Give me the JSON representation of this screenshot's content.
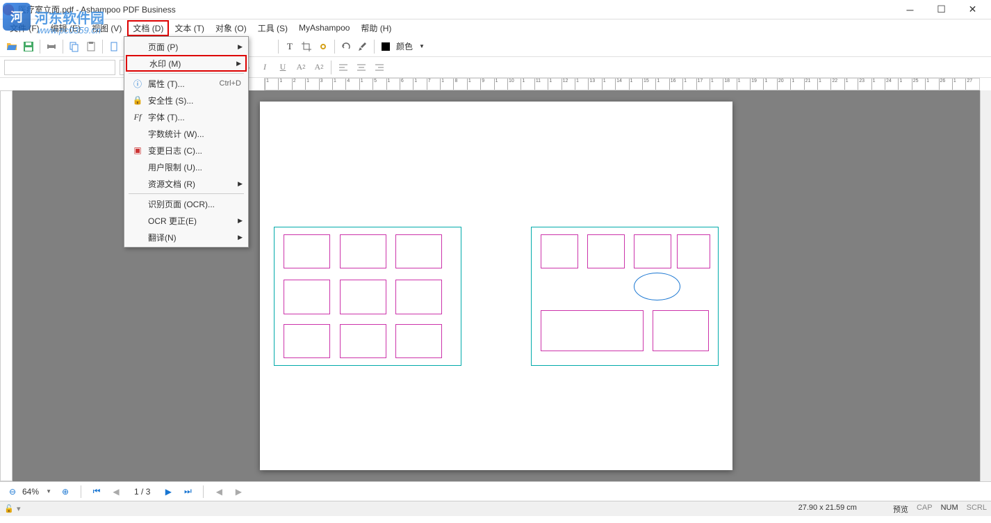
{
  "title": "医疗室立面.pdf - Ashampoo PDF Business",
  "watermark": {
    "brand": "河东软件园",
    "url": "www.pc0359.cn"
  },
  "menubar": {
    "file": "文件 (F)",
    "edit": "编辑 (E)",
    "view": "视图 (V)",
    "document": "文档 (D)",
    "text": "文本 (T)",
    "object": "对象 (O)",
    "tools": "工具 (S)",
    "myashampoo": "MyAshampoo",
    "help": "帮助 (H)"
  },
  "dropdown": {
    "page": "页面 (P)",
    "watermark": "水印 (M)",
    "properties": "属性 (T)...",
    "properties_shortcut": "Ctrl+D",
    "security": "安全性 (S)...",
    "font": "字体 (T)...",
    "wordcount": "字数统计 (W)...",
    "changelog": "变更日志 (C)...",
    "userlimit": "用户限制 (U)...",
    "resource": "资源文档 (R)",
    "ocr_page": "识别页面 (OCR)...",
    "ocr_fix": "OCR 更正(E)",
    "translate": "翻译(N)"
  },
  "toolbar": {
    "color_label": "颜色"
  },
  "ruler": [
    "1",
    "1",
    "2",
    "1",
    "3",
    "1",
    "4",
    "1",
    "5",
    "1",
    "6",
    "1",
    "7",
    "1",
    "8",
    "1",
    "9",
    "1",
    "10",
    "1",
    "11",
    "1",
    "12",
    "1",
    "13",
    "1",
    "14",
    "1",
    "15",
    "1",
    "16",
    "1",
    "17",
    "1",
    "18",
    "1",
    "19",
    "1",
    "20",
    "1",
    "21",
    "1",
    "22",
    "1",
    "23",
    "1",
    "24",
    "1",
    "25",
    "1",
    "26",
    "1",
    "27"
  ],
  "nav": {
    "zoom": "64%",
    "page": "1 / 3"
  },
  "status": {
    "dimensions": "27.90 x 21.59 cm",
    "preview": "预览",
    "cap": "CAP",
    "num": "NUM",
    "scrl": "SCRL"
  }
}
